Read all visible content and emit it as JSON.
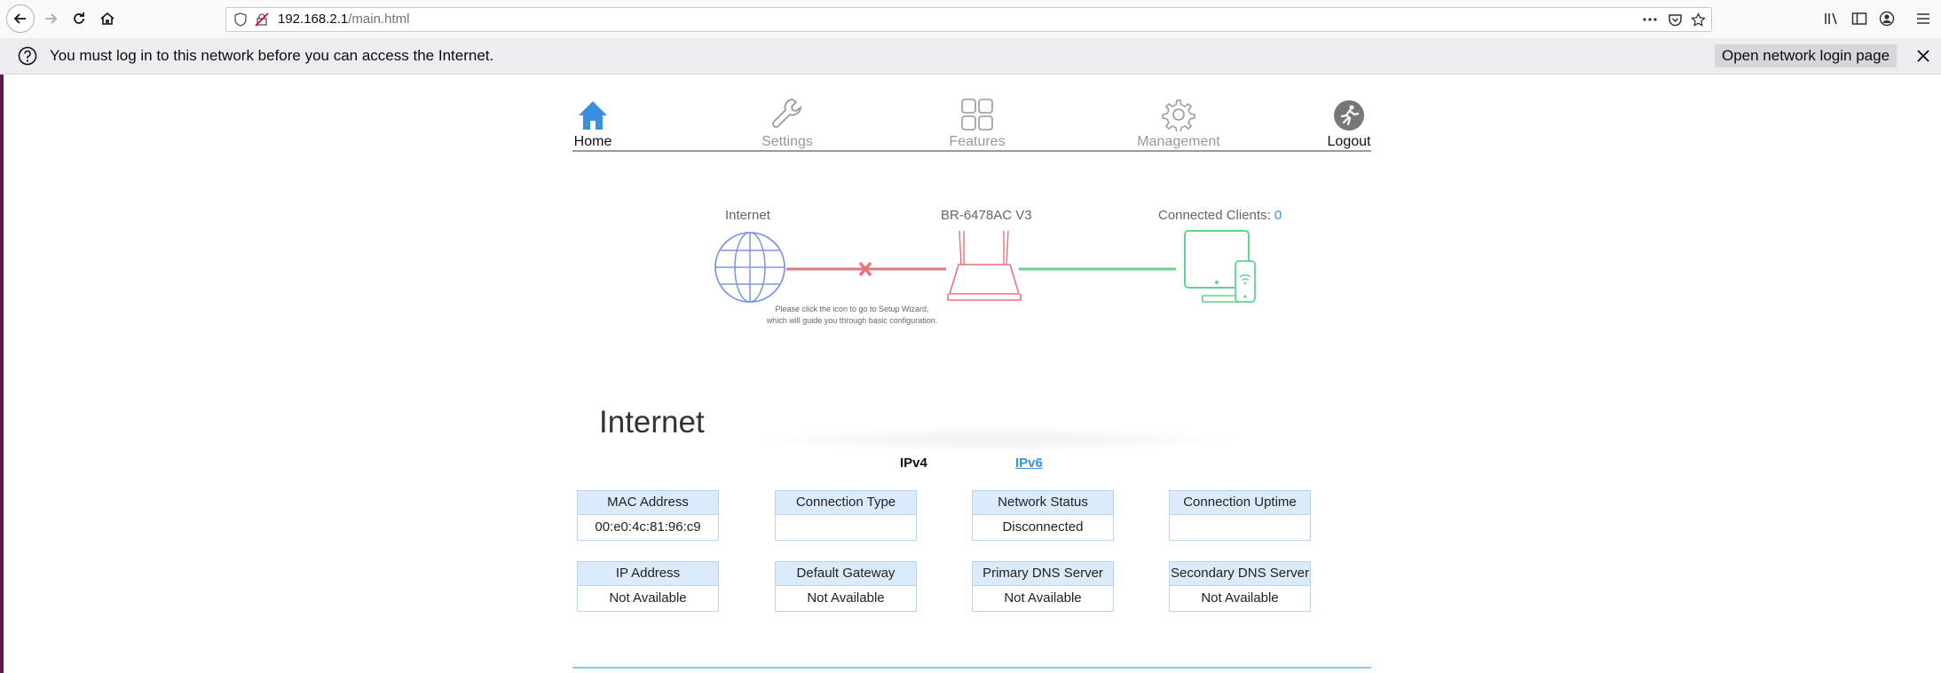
{
  "browser": {
    "url_host": "192.168.2.1",
    "url_path": "/main.html",
    "icons": [
      "back-arrow-icon",
      "forward-arrow-icon",
      "reload-icon",
      "home-icon",
      "shield-icon",
      "insecure-lock-icon",
      "more-icon",
      "pocket-icon",
      "star-icon",
      "library-icon",
      "sidebar-icon",
      "account-icon",
      "menu-icon"
    ]
  },
  "notification": {
    "message": "You must log in to this network before you can access the Internet.",
    "button": "Open network login page"
  },
  "nav": {
    "items": [
      {
        "label": "Home",
        "icon": "house-icon"
      },
      {
        "label": "Settings",
        "icon": "wrench-icon"
      },
      {
        "label": "Features",
        "icon": "grid-icon"
      },
      {
        "label": "Management",
        "icon": "gear-icon"
      },
      {
        "label": "Logout",
        "icon": "logout-icon"
      }
    ],
    "active": "Home"
  },
  "diagram": {
    "internet_label": "Internet",
    "router_label": "BR-6478AC V3",
    "clients_label": "Connected Clients:",
    "clients_count": "0",
    "note_line1": "Please click the icon to go to Setup Wizard,",
    "note_line2": "which will guide you through basic configuration.",
    "colors": {
      "disconnected": "#e8737a",
      "connected": "#5fd58e",
      "globe": "#7a97e0"
    }
  },
  "internet": {
    "title": "Internet",
    "tabs": {
      "ipv4": "IPv4",
      "ipv6": "IPv6"
    },
    "fields": [
      {
        "label": "MAC Address",
        "value": "00:e0:4c:81:96:c9"
      },
      {
        "label": "Connection Type",
        "value": ""
      },
      {
        "label": "Network Status",
        "value": "Disconnected"
      },
      {
        "label": "Connection Uptime",
        "value": ""
      },
      {
        "label": "IP Address",
        "value": "Not Available"
      },
      {
        "label": "Default Gateway",
        "value": "Not Available"
      },
      {
        "label": "Primary DNS Server",
        "value": "Not Available"
      },
      {
        "label": "Secondary DNS Server",
        "value": "Not Available"
      }
    ]
  }
}
